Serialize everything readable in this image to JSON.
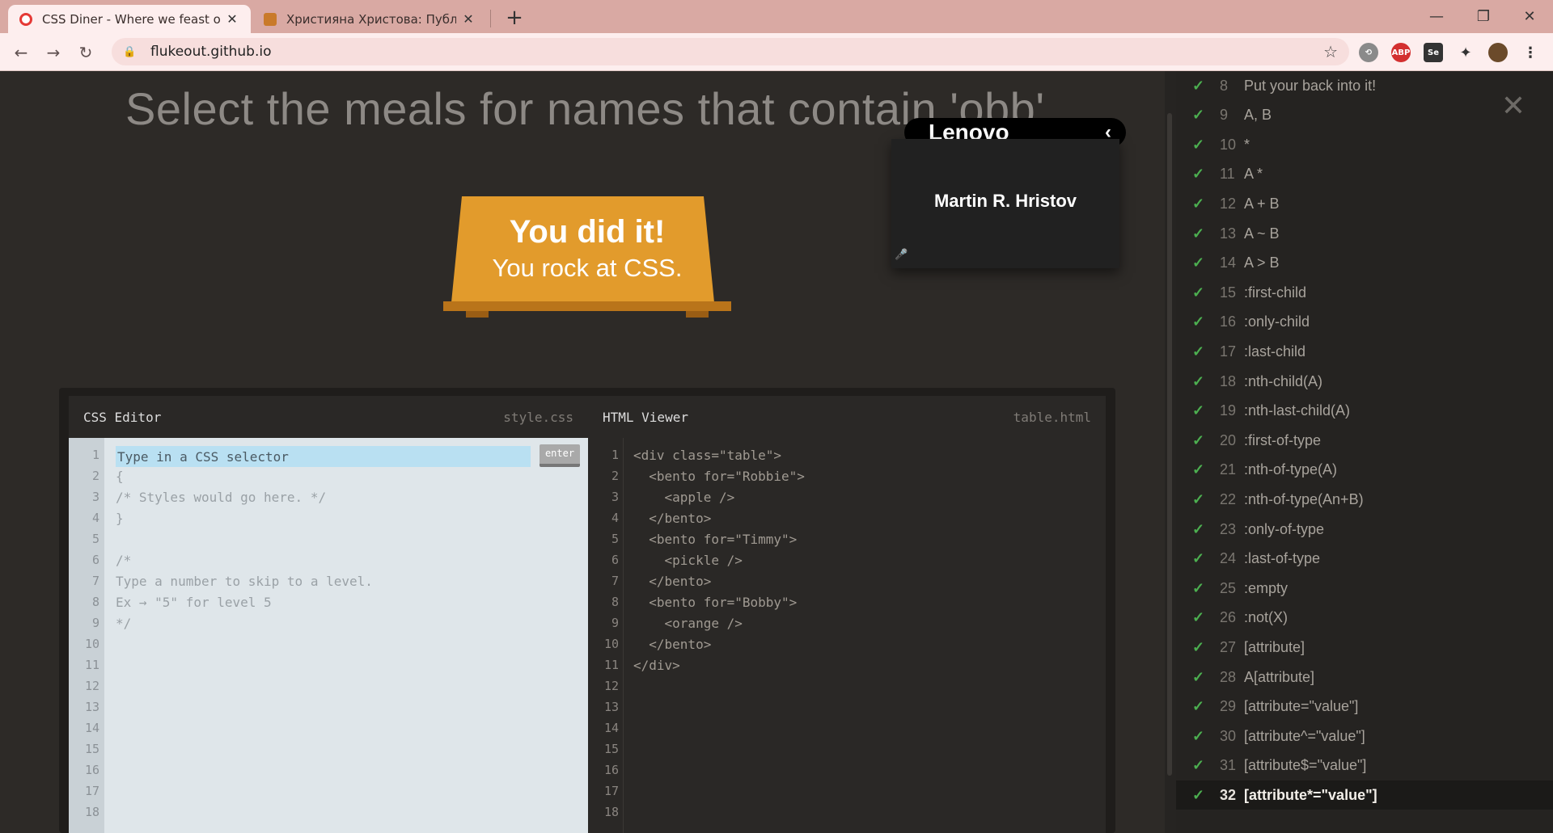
{
  "browser": {
    "tabs": [
      {
        "title": "CSS Diner - Where we feast on CSS",
        "active": true
      },
      {
        "title": "Християна Христова: Публичен",
        "active": false
      }
    ],
    "url": "flukeout.github.io",
    "window_controls": {
      "minimize": "—",
      "maximize": "❐",
      "close": "✕"
    }
  },
  "game": {
    "instruction": "Select the meals for names that contain 'obb'",
    "win_title": "You did it!",
    "win_subtitle": "You rock at CSS.",
    "colors": {
      "table": "#e29b2c",
      "background": "#2d2a27"
    }
  },
  "video_overlay": {
    "brand": "Lenovo",
    "participant": "Martin R. Hristov"
  },
  "css_editor": {
    "title": "CSS Editor",
    "filename": "style.css",
    "input_placeholder": "Type in a CSS selector",
    "enter_label": "enter",
    "line_numbers": [
      "1",
      "2",
      "3",
      "4",
      "5",
      "6",
      "7",
      "8",
      "9",
      "10",
      "11",
      "12",
      "13",
      "14",
      "15",
      "16",
      "17",
      "18"
    ],
    "lines": [
      "{",
      "/* Styles would go here. */",
      "}",
      "",
      "/*",
      "Type a number to skip to a level.",
      "Ex → \"5\" for level 5",
      "*/"
    ]
  },
  "html_viewer": {
    "title": "HTML Viewer",
    "filename": "table.html",
    "line_numbers": [
      "1",
      "2",
      "3",
      "4",
      "5",
      "6",
      "7",
      "8",
      "9",
      "10",
      "11",
      "12",
      "13",
      "14",
      "15",
      "16",
      "17",
      "18"
    ],
    "lines": [
      "<div class=\"table\">",
      "  <bento for=\"Robbie\">",
      "    <apple />",
      "  </bento>",
      "  <bento for=\"Timmy\">",
      "    <pickle />",
      "  </bento>",
      "  <bento for=\"Bobby\">",
      "    <orange />",
      "  </bento>",
      "</div>"
    ]
  },
  "levels": [
    {
      "num": "8",
      "selector": "Put your back into it!"
    },
    {
      "num": "9",
      "selector": "A, B"
    },
    {
      "num": "10",
      "selector": "*"
    },
    {
      "num": "11",
      "selector": "A *"
    },
    {
      "num": "12",
      "selector": "A + B"
    },
    {
      "num": "13",
      "selector": "A ~ B"
    },
    {
      "num": "14",
      "selector": "A > B"
    },
    {
      "num": "15",
      "selector": ":first-child"
    },
    {
      "num": "16",
      "selector": ":only-child"
    },
    {
      "num": "17",
      "selector": ":last-child"
    },
    {
      "num": "18",
      "selector": ":nth-child(A)"
    },
    {
      "num": "19",
      "selector": ":nth-last-child(A)"
    },
    {
      "num": "20",
      "selector": ":first-of-type"
    },
    {
      "num": "21",
      "selector": ":nth-of-type(A)"
    },
    {
      "num": "22",
      "selector": ":nth-of-type(An+B)"
    },
    {
      "num": "23",
      "selector": ":only-of-type"
    },
    {
      "num": "24",
      "selector": ":last-of-type"
    },
    {
      "num": "25",
      "selector": ":empty"
    },
    {
      "num": "26",
      "selector": ":not(X)"
    },
    {
      "num": "27",
      "selector": "[attribute]"
    },
    {
      "num": "28",
      "selector": "A[attribute]"
    },
    {
      "num": "29",
      "selector": "[attribute=\"value\"]"
    },
    {
      "num": "30",
      "selector": "[attribute^=\"value\"]"
    },
    {
      "num": "31",
      "selector": "[attribute$=\"value\"]"
    },
    {
      "num": "32",
      "selector": "[attribute*=\"value\"]"
    }
  ],
  "current_level": "32",
  "check_icon": "✓",
  "check_color": "#4caf50"
}
